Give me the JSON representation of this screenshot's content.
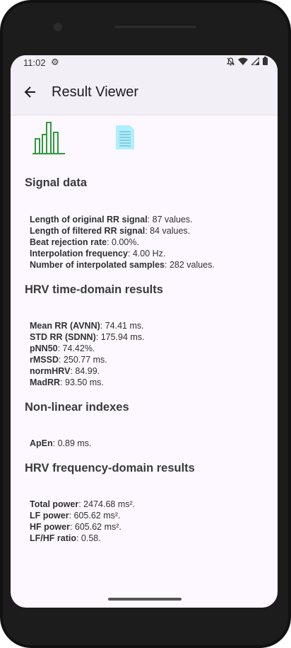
{
  "status_bar": {
    "time": "11:02"
  },
  "app_bar": {
    "title": "Result Viewer"
  },
  "icons": {
    "chart": "bar-chart-icon",
    "document": "document-icon",
    "back": "arrow-back-icon"
  },
  "colors": {
    "chart_icon": "#2e9a3a",
    "document_icon": "#aeefff",
    "screen_bg": "#fdf8ff",
    "app_bar_bg": "#f2eff6"
  },
  "sections": {
    "signal": {
      "title": "Signal data",
      "rows": [
        {
          "label": "Length of original RR signal",
          "value": ": 87 values."
        },
        {
          "label": "Length of filtered RR signal",
          "value": ": 84 values."
        },
        {
          "label": "Beat rejection rate",
          "value": ": 0.00%."
        },
        {
          "label": "Interpolation frequency",
          "value": ": 4.00 Hz."
        },
        {
          "label": "Number of interpolated samples",
          "value": ": 282 values."
        }
      ]
    },
    "time": {
      "title": "HRV time-domain results",
      "rows": [
        {
          "label": "Mean RR (AVNN)",
          "value": ": 74.41 ms."
        },
        {
          "label": "STD RR (SDNN)",
          "value": ": 175.94 ms."
        },
        {
          "label": "pNN50",
          "value": ": 74.42%."
        },
        {
          "label": "rMSSD",
          "value": ": 250.77 ms."
        },
        {
          "label": "normHRV",
          "value": ": 84.99."
        },
        {
          "label": "MadRR",
          "value": ": 93.50 ms."
        }
      ]
    },
    "nonlinear": {
      "title": "Non-linear indexes",
      "rows": [
        {
          "label": "ApEn",
          "value": ": 0.89 ms."
        }
      ]
    },
    "freq": {
      "title": "HRV frequency-domain results",
      "rows": [
        {
          "label": "Total power",
          "value": ": 2474.68 ms²."
        },
        {
          "label": "LF power",
          "value": ": 605.62 ms²."
        },
        {
          "label": "HF power",
          "value": ": 605.62 ms²."
        },
        {
          "label": "LF/HF ratio",
          "value": ": 0.58."
        }
      ]
    }
  }
}
